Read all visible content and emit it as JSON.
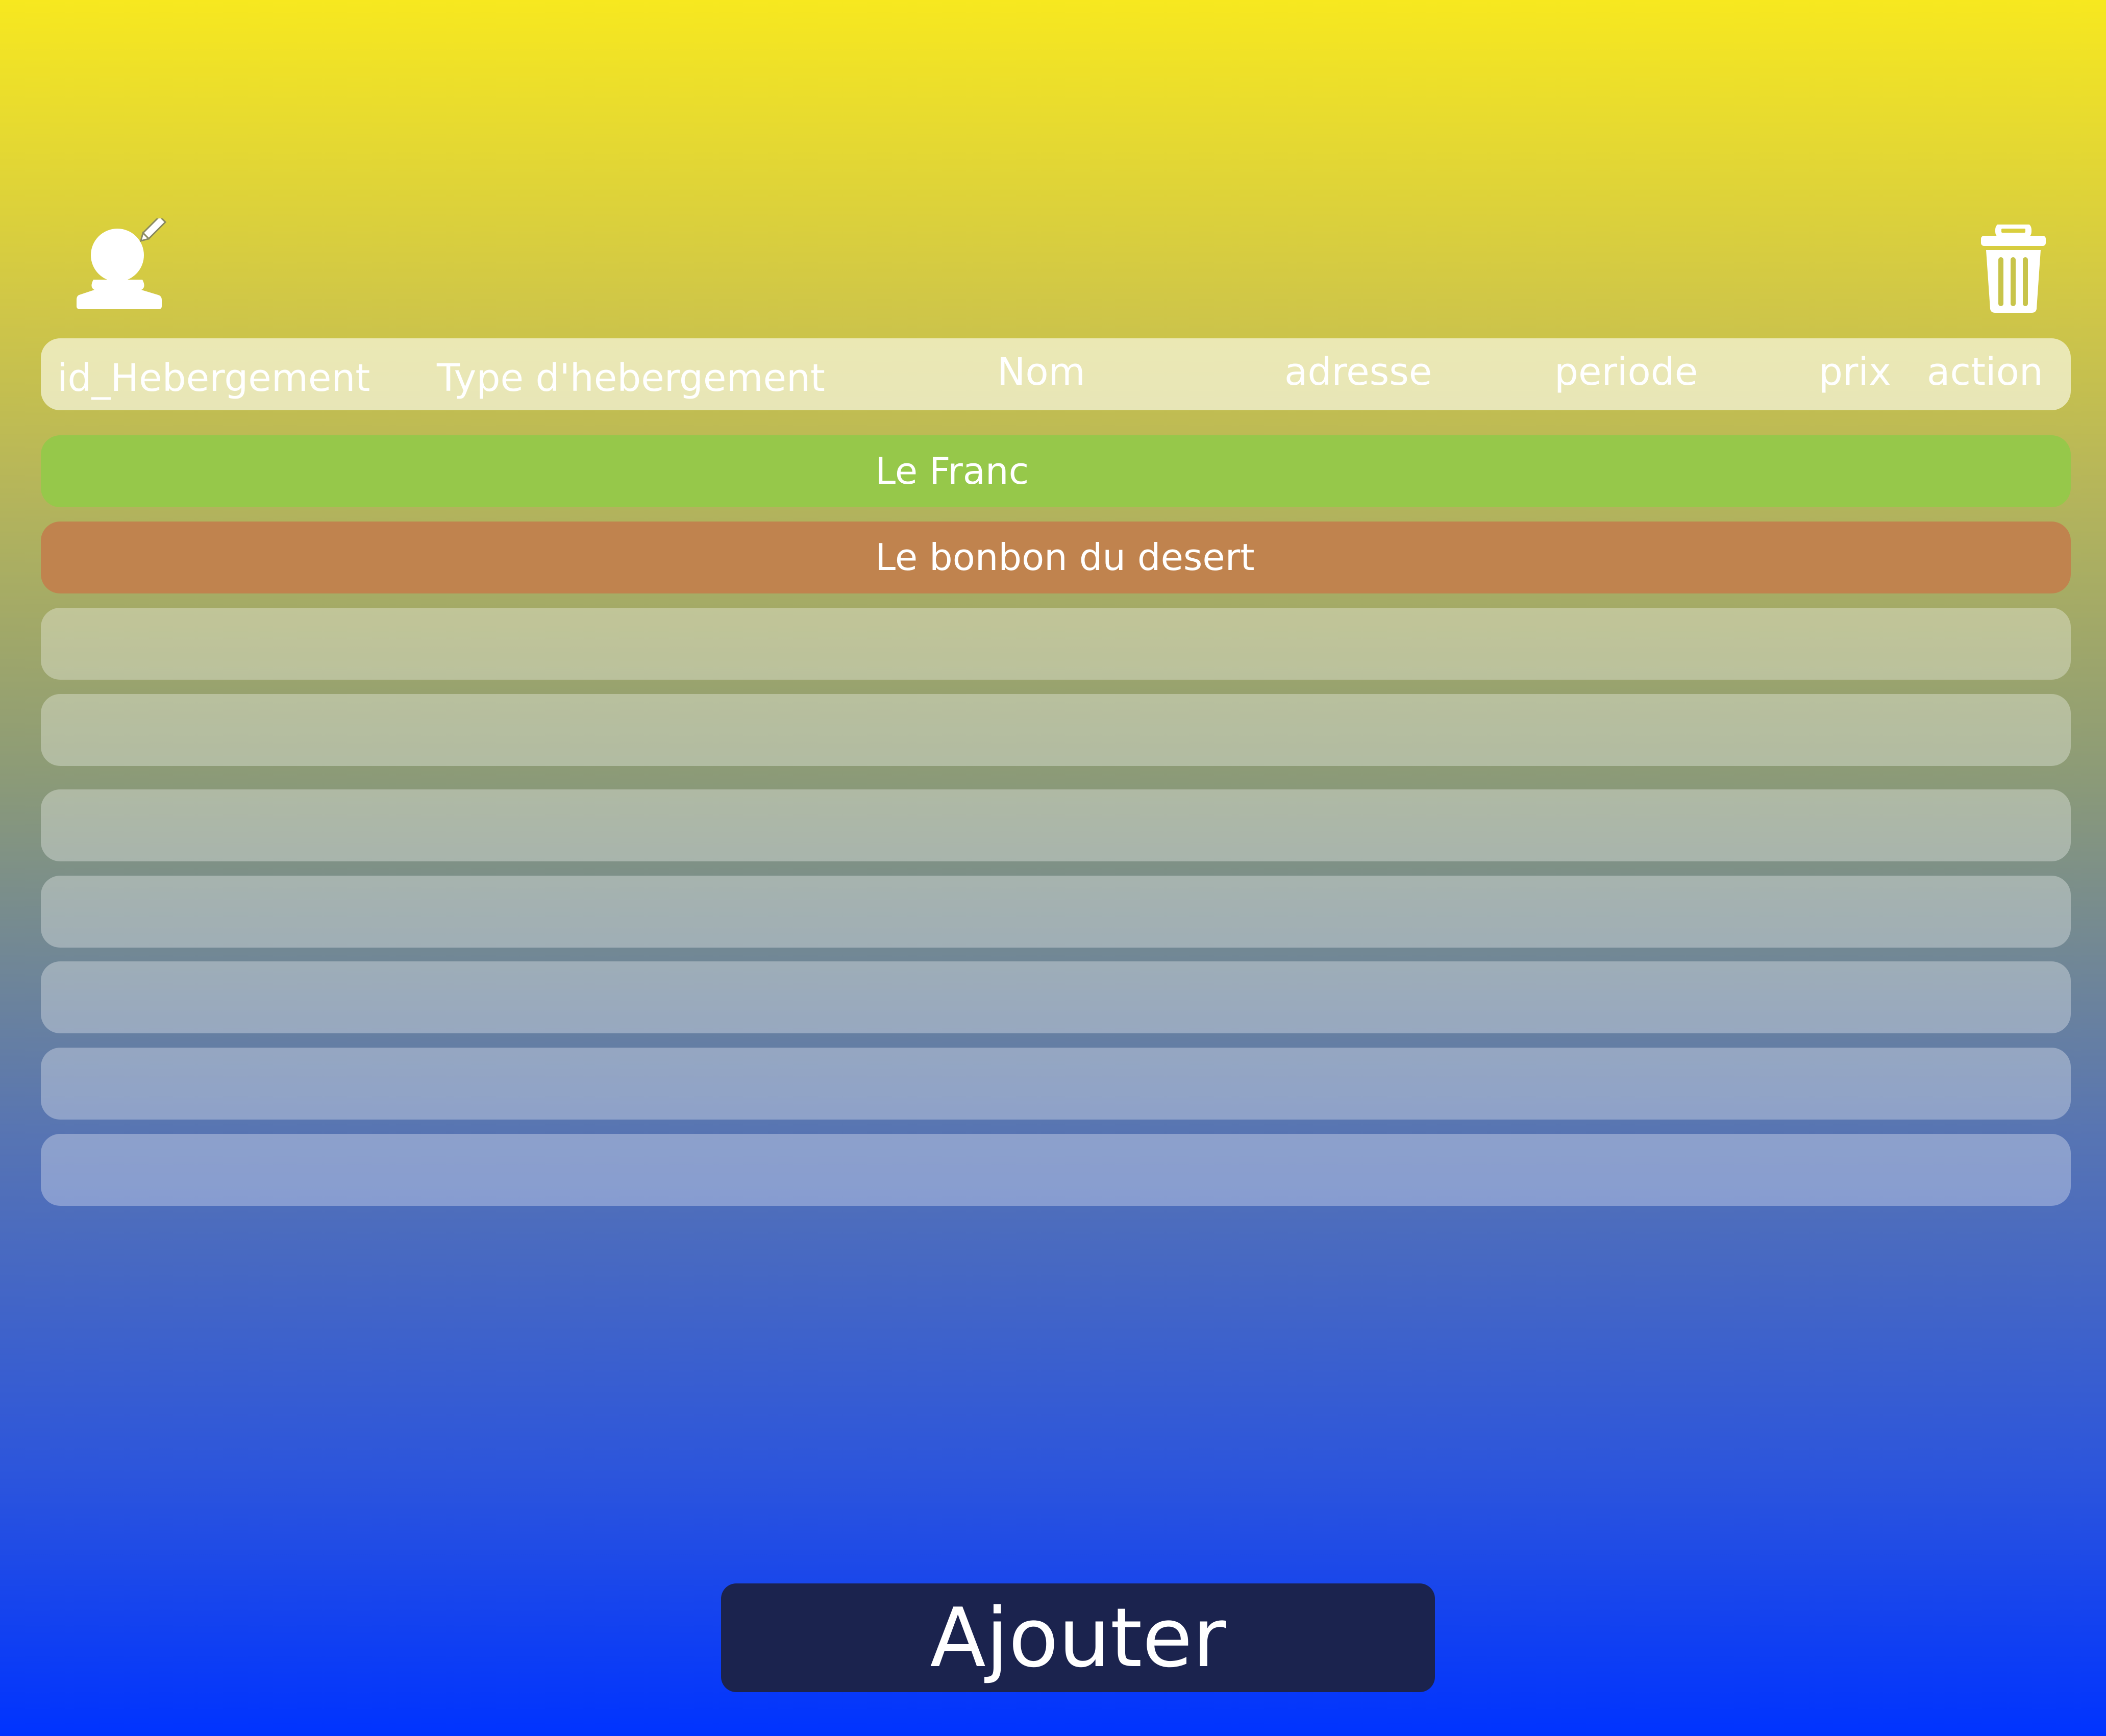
{
  "colors": {
    "header_bg": "#f0f0d6",
    "row_green": "#96c84a",
    "row_orange": "#c0834e",
    "button_bg": "#1b234e",
    "gradient_top": "#f7e81f",
    "gradient_bottom": "#0033ff"
  },
  "icons": {
    "edit_user": "user-edit-icon",
    "trash": "trash-icon"
  },
  "table": {
    "headers": {
      "id": "id_Hebergement",
      "type": "Type d'hebergement",
      "nom": "Nom",
      "adresse": "adresse",
      "periode": "periode",
      "prix": "prix",
      "action": "action"
    },
    "rows": [
      {
        "nom": "Le Franc"
      },
      {
        "nom": "Le bonbon du desert"
      }
    ]
  },
  "add_button": {
    "label": "Ajouter"
  }
}
